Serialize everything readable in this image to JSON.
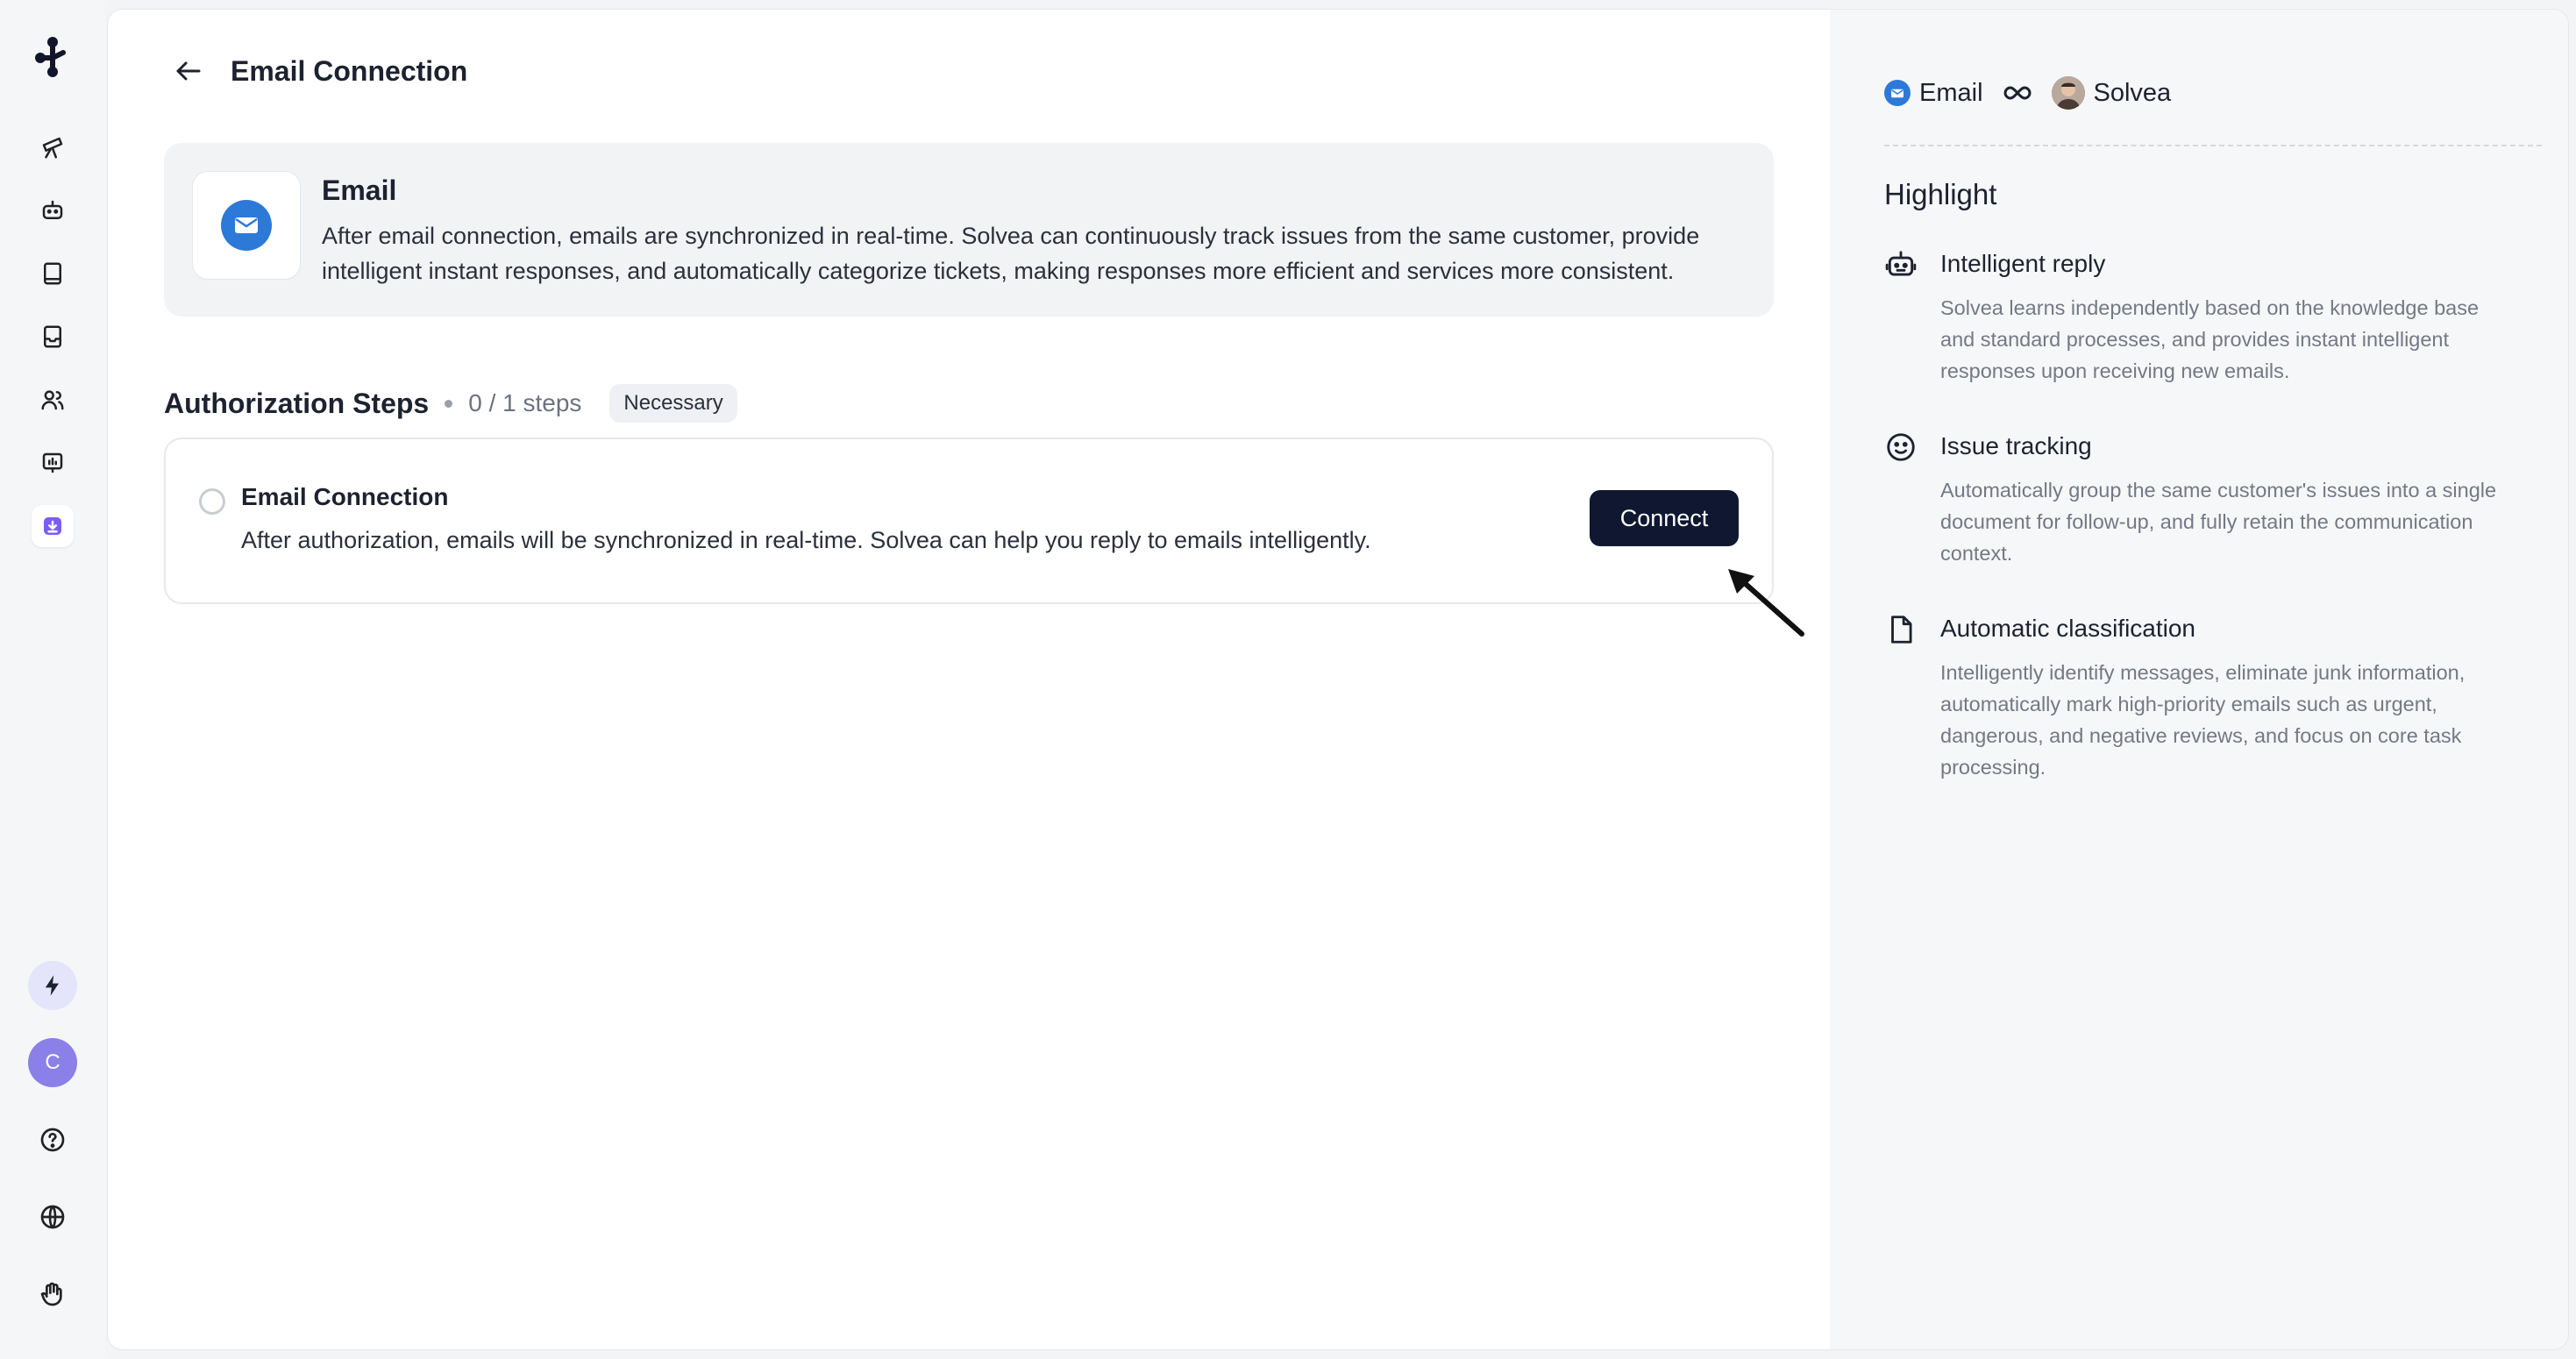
{
  "nav": {
    "items": [
      {
        "name": "nav-campaigns",
        "icon": "telescope-icon"
      },
      {
        "name": "nav-agent",
        "icon": "robot-icon"
      },
      {
        "name": "nav-knowledge",
        "icon": "book-icon"
      },
      {
        "name": "nav-inbox",
        "icon": "inbox-icon"
      },
      {
        "name": "nav-customers",
        "icon": "users-icon"
      },
      {
        "name": "nav-analytics",
        "icon": "chart-icon"
      },
      {
        "name": "nav-integrations",
        "icon": "download-box-icon",
        "active": true
      }
    ],
    "avatar_initial": "C"
  },
  "header": {
    "title": "Email Connection"
  },
  "channel": {
    "name": "Email",
    "description": "After email connection, emails are synchronized in real-time. Solvea can continuously track issues from the same customer, provide intelligent instant responses, and automatically categorize tickets, making responses more efficient and services more consistent."
  },
  "steps": {
    "title": "Authorization Steps",
    "count": "0 / 1 steps",
    "badge": "Necessary",
    "items": [
      {
        "title": "Email Connection",
        "description": "After authorization, emails will be synchronized in real-time. Solvea can help you reply to emails intelligently.",
        "button": "Connect"
      }
    ]
  },
  "side": {
    "from_label": "Email",
    "to_label": "Solvea",
    "highlight_title": "Highlight",
    "highlights": [
      {
        "icon": "robot-icon",
        "title": "Intelligent reply",
        "description": "Solvea learns independently based on the knowledge base and standard processes, and provides instant intelligent responses upon receiving new emails."
      },
      {
        "icon": "smile-icon",
        "title": "Issue tracking",
        "description": "Automatically group the same customer's issues into a single document for follow-up, and fully retain the communication context."
      },
      {
        "icon": "file-icon",
        "title": "Automatic classification",
        "description": "Intelligently identify messages, eliminate junk information, automatically mark high-priority emails such as urgent, dangerous, and negative reviews, and focus on core task processing."
      }
    ]
  },
  "colors": {
    "primary_button": "#0f1830",
    "email_blue": "#2d79d8",
    "avatar_purple": "#8b7fe8"
  }
}
